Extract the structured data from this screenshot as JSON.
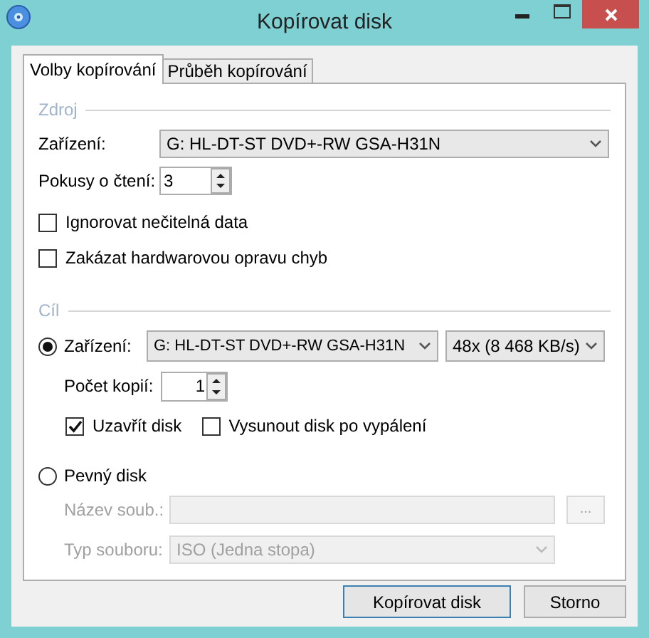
{
  "window": {
    "title": "Kopírovat disk"
  },
  "tabs": [
    {
      "label": "Volby kopírování",
      "selected": true
    },
    {
      "label": "Průběh kopírování",
      "selected": false
    }
  ],
  "source": {
    "heading": "Zdroj",
    "device_label": "Zařízení:",
    "device": "G: HL-DT-ST DVD+-RW GSA-H31N",
    "retries_label": "Pokusy o čtení:",
    "retries": "3",
    "options": [
      {
        "label": "Ignorovat nečitelná data",
        "checked": false
      },
      {
        "label": "Zakázat hardwarovou opravu chyb",
        "checked": false
      }
    ]
  },
  "target": {
    "heading": "Cíl",
    "drive": {
      "label": "Zařízení:",
      "selected": true,
      "device": "G: HL-DT-ST DVD+-RW GSA-H31N",
      "speed": "48x (8 468 KB/s)",
      "copies_label": "Počet kopií:",
      "copies": "1",
      "options": [
        {
          "label": "Uzavřít disk",
          "checked": true
        },
        {
          "label": "Vysunout disk po vypálení",
          "checked": false
        }
      ]
    },
    "hard_disk": {
      "label": "Pevný disk",
      "selected": false,
      "filename_label": "Název soub.:",
      "browse": "...",
      "filetype_label": "Typ souboru:",
      "filetype": "ISO (Jedna stopa)",
      "disabled": true
    }
  },
  "buttons": [
    {
      "label": "Kopírovat disk",
      "default": true
    },
    {
      "label": "Storno",
      "default": false
    }
  ]
}
